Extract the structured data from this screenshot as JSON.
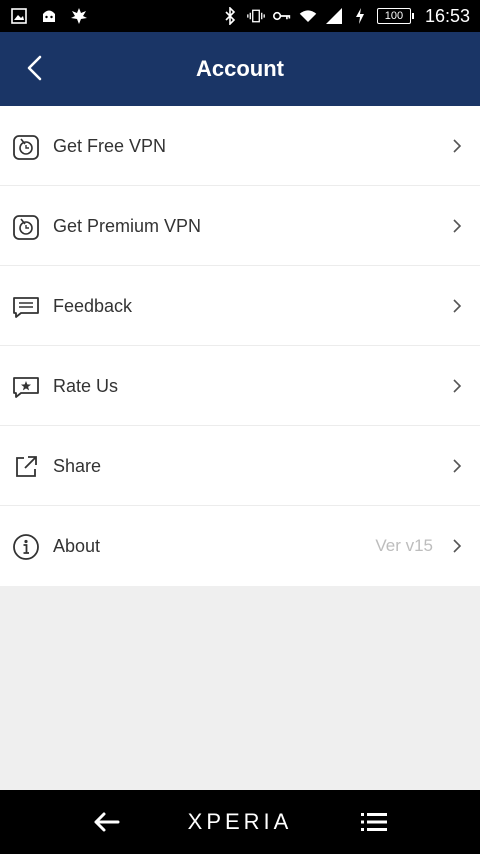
{
  "status_bar": {
    "time": "16:53",
    "battery": "100",
    "left_icons": [
      "gallery-icon",
      "android-icon",
      "leaf-icon"
    ],
    "right_icons": [
      "bluetooth-icon",
      "vibrate-icon",
      "vpn-key-icon",
      "wifi-icon",
      "signal-icon",
      "charging-icon"
    ]
  },
  "app_bar": {
    "title": "Account",
    "back_icon": "chevron-left-icon"
  },
  "menu": {
    "items": [
      {
        "label": "Get Free VPN",
        "icon": "vpn-shield-icon",
        "value": ""
      },
      {
        "label": "Get Premium VPN",
        "icon": "vpn-shield-icon",
        "value": ""
      },
      {
        "label": "Feedback",
        "icon": "message-icon",
        "value": ""
      },
      {
        "label": "Rate Us",
        "icon": "star-message-icon",
        "value": ""
      },
      {
        "label": "Share",
        "icon": "share-icon",
        "value": ""
      },
      {
        "label": "About",
        "icon": "info-icon",
        "value": "Ver v15"
      }
    ]
  },
  "nav_bar": {
    "brand": "XPERIA",
    "back_icon": "arrow-left-icon",
    "menu_icon": "menu-icon"
  },
  "colors": {
    "app_bar": "#1a3566",
    "background": "#efefef",
    "text": "#333333",
    "muted": "#bdbdbd"
  }
}
